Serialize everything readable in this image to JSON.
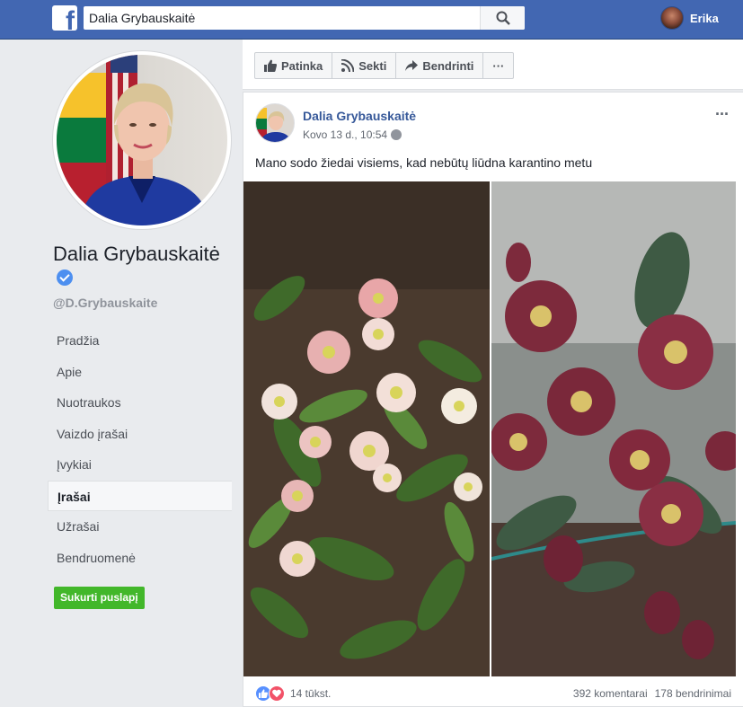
{
  "header": {
    "search_value": "Dalia Grybauskaitė",
    "user_name": "Erika"
  },
  "sidebar": {
    "page_name": "Dalia Grybauskaitė",
    "handle": "@D.Grybauskaite",
    "items": [
      {
        "label": "Pradžia",
        "active": false
      },
      {
        "label": "Apie",
        "active": false
      },
      {
        "label": "Nuotraukos",
        "active": false
      },
      {
        "label": "Vaizdo įrašai",
        "active": false
      },
      {
        "label": "Įvykiai",
        "active": false
      },
      {
        "label": "Įrašai",
        "active": true
      },
      {
        "label": "Užrašai",
        "active": false
      },
      {
        "label": "Bendruomenė",
        "active": false
      }
    ],
    "create_page_label": "Sukurti puslapį"
  },
  "actions": {
    "like_label": "Patinka",
    "follow_label": "Sekti",
    "share_label": "Bendrinti",
    "more_label": "···"
  },
  "post": {
    "author": "Dalia Grybauskaitė",
    "time": "Kovo 13 d., 10:54",
    "more_label": "···",
    "text": "Mano sodo žiedai visiems, kad nebūtų liūdna karantino metu",
    "reaction_count": "14 tūkst.",
    "comments": "392 komentarai",
    "shares": "178 bendrinimai"
  },
  "colors": {
    "brand": "#4267b2",
    "link": "#365899",
    "create_button": "#42b72a",
    "like_reaction": "#5890ff",
    "love_reaction": "#f25268"
  }
}
